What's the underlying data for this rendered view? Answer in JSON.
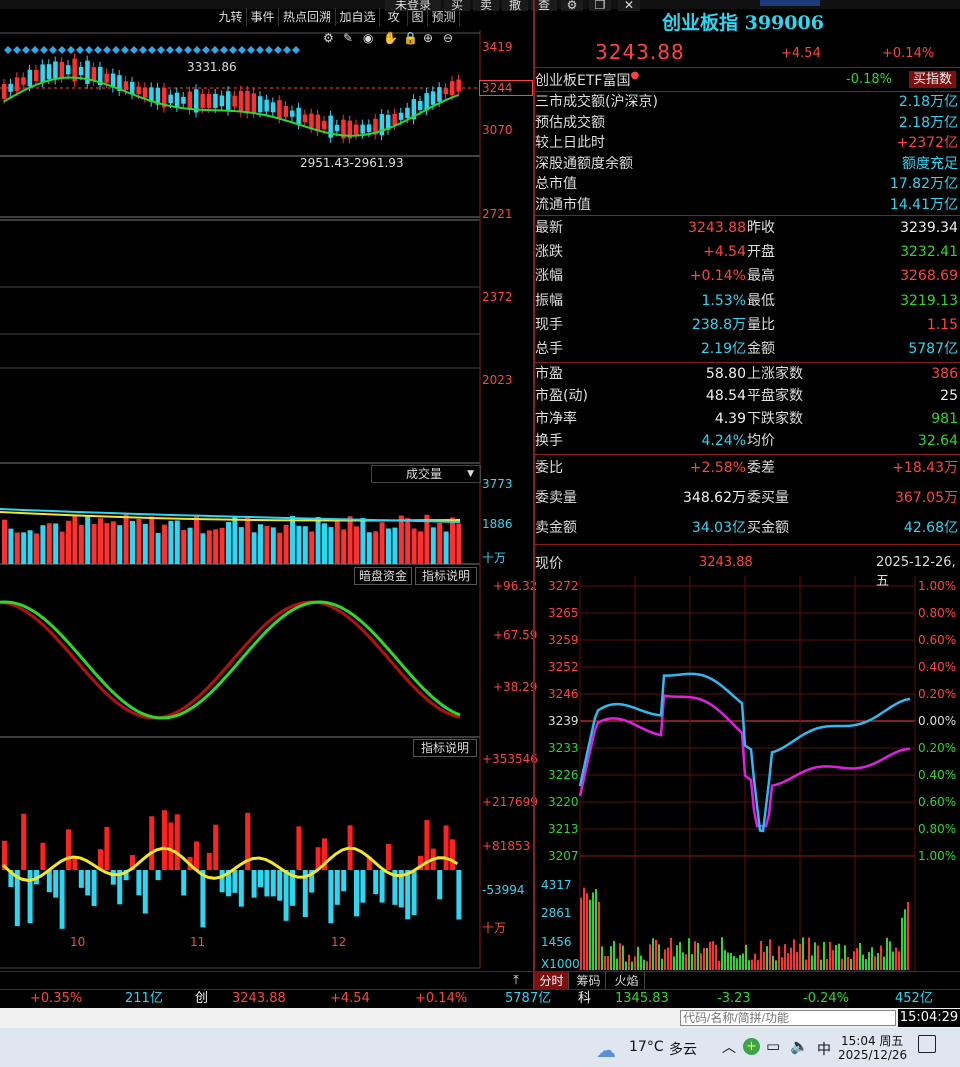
{
  "toolbar": {
    "items": [
      "九转",
      "事件",
      "热点回溯",
      "加自选",
      "攻",
      "图",
      "预测"
    ]
  },
  "top_strip": {
    "items": [
      "未登录",
      "买",
      "卖",
      "撤",
      "查"
    ]
  },
  "index": {
    "name": "创业板指 399006",
    "price": "3243.88",
    "change": "+4.54",
    "pct": "+0.14%"
  },
  "etf": {
    "label": "创业板ETF富国",
    "pct": "-0.18%",
    "button": "买指数"
  },
  "market_rows": [
    {
      "label": "三市成交额(沪深京)",
      "value": "2.18万亿",
      "color": "cy"
    },
    {
      "label": "预估成交额",
      "value": "2.18万亿",
      "color": "cy"
    },
    {
      "label": "较上日此时",
      "value": "+2372亿",
      "color": "red"
    },
    {
      "label": "深股通额度余额",
      "value": "额度充足",
      "color": "cy"
    },
    {
      "label": "总市值",
      "value": "17.82万亿",
      "color": "cy"
    },
    {
      "label": "流通市值",
      "value": "14.41万亿",
      "color": "cy"
    }
  ],
  "quote_grid": [
    {
      "l1": "最新",
      "v1": "3243.88",
      "c1": "red",
      "l2": "昨收",
      "v2": "3239.34",
      "c2": "wh"
    },
    {
      "l1": "涨跌",
      "v1": "+4.54",
      "c1": "red",
      "l2": "开盘",
      "v2": "3232.41",
      "c2": "grn"
    },
    {
      "l1": "涨幅",
      "v1": "+0.14%",
      "c1": "red",
      "l2": "最高",
      "v2": "3268.69",
      "c2": "red"
    },
    {
      "l1": "振幅",
      "v1": "1.53%",
      "c1": "cy",
      "l2": "最低",
      "v2": "3219.13",
      "c2": "grn"
    },
    {
      "l1": "现手",
      "v1": "238.8万",
      "c1": "cy",
      "l2": "量比",
      "v2": "1.15",
      "c2": "red"
    },
    {
      "l1": "总手",
      "v1": "2.19亿",
      "c1": "cy",
      "l2": "金额",
      "v2": "5787亿",
      "c2": "cy"
    }
  ],
  "stats_grid": [
    {
      "l1": "市盈",
      "v1": "58.80",
      "c1": "wh",
      "l2": "上涨家数",
      "v2": "386",
      "c2": "red"
    },
    {
      "l1": "市盈(动)",
      "v1": "48.54",
      "c1": "wh",
      "l2": "平盘家数",
      "v2": "25",
      "c2": "wh"
    },
    {
      "l1": "市净率",
      "v1": "4.39",
      "c1": "wh",
      "l2": "下跌家数",
      "v2": "981",
      "c2": "grn"
    },
    {
      "l1": "换手",
      "v1": "4.24%",
      "c1": "cy",
      "l2": "均价",
      "v2": "32.64",
      "c2": "grn"
    }
  ],
  "order_grid": [
    {
      "l1": "委比",
      "v1": "+2.58%",
      "c1": "red",
      "l2": "委差",
      "v2": "+18.43万",
      "c2": "red"
    },
    {
      "l1": "委卖量",
      "v1": "348.62万",
      "c1": "wh",
      "l2": "委买量",
      "v2": "367.05万",
      "c2": "red"
    },
    {
      "l1": "卖金额",
      "v1": "34.03亿",
      "c1": "cy",
      "l2": "买金额",
      "v2": "42.68亿",
      "c2": "cy"
    }
  ],
  "intraday": {
    "label": "现价",
    "price": "3243.88",
    "date": "2025-12-26,五",
    "y_left": [
      "3272",
      "3265",
      "3259",
      "3252",
      "3246",
      "3239",
      "3233",
      "3226",
      "3220",
      "3213",
      "3207"
    ],
    "y_right": [
      "1.00%",
      "0.80%",
      "0.60%",
      "0.40%",
      "0.20%",
      "0.00%",
      "0.20%",
      "0.40%",
      "0.60%",
      "0.80%",
      "1.00%"
    ],
    "vol_ticks": [
      "4317",
      "2861",
      "1456",
      "X1000"
    ]
  },
  "kline": {
    "high_label": "3331.86",
    "low_label": "2951.43-2961.93",
    "y_ticks": [
      "3419",
      "3244",
      "3070",
      "2721",
      "2372",
      "2023"
    ],
    "vol_label": "成交量",
    "vol_ticks": [
      "3773",
      "1886",
      "十万"
    ],
    "ind1_btns": [
      "暗盘资金",
      "指标说明"
    ],
    "ind1_ticks": [
      "+96.32",
      "+67.59",
      "+38.29"
    ],
    "ind2_btn": "指标说明",
    "ind2_ticks": [
      "+353546",
      "+217699",
      "+81853",
      "-53994",
      "十万"
    ],
    "x_ticks": [
      "10",
      "11",
      "12"
    ]
  },
  "tabs": {
    "items": [
      "分时",
      "筹码",
      "火焰"
    ]
  },
  "ticker": {
    "a_pct": "+0.35%",
    "a_amt": "211亿",
    "b_name": "创",
    "b_price": "3243.88",
    "b_chg": "+4.54",
    "b_pct": "+0.14%",
    "b_amt": "5787亿",
    "c_name": "科",
    "c_price": "1345.83",
    "c_chg": "-3.23",
    "c_pct": "-0.24%",
    "c_amt": "452亿"
  },
  "search": {
    "placeholder": "代码/名称/简拼/功能",
    "time": "15:04:29"
  },
  "taskbar": {
    "weather_temp": "17°C",
    "weather_text": "多云",
    "ime": "中",
    "clock_time": "15:04 周五",
    "clock_date": "2025/12/26"
  }
}
